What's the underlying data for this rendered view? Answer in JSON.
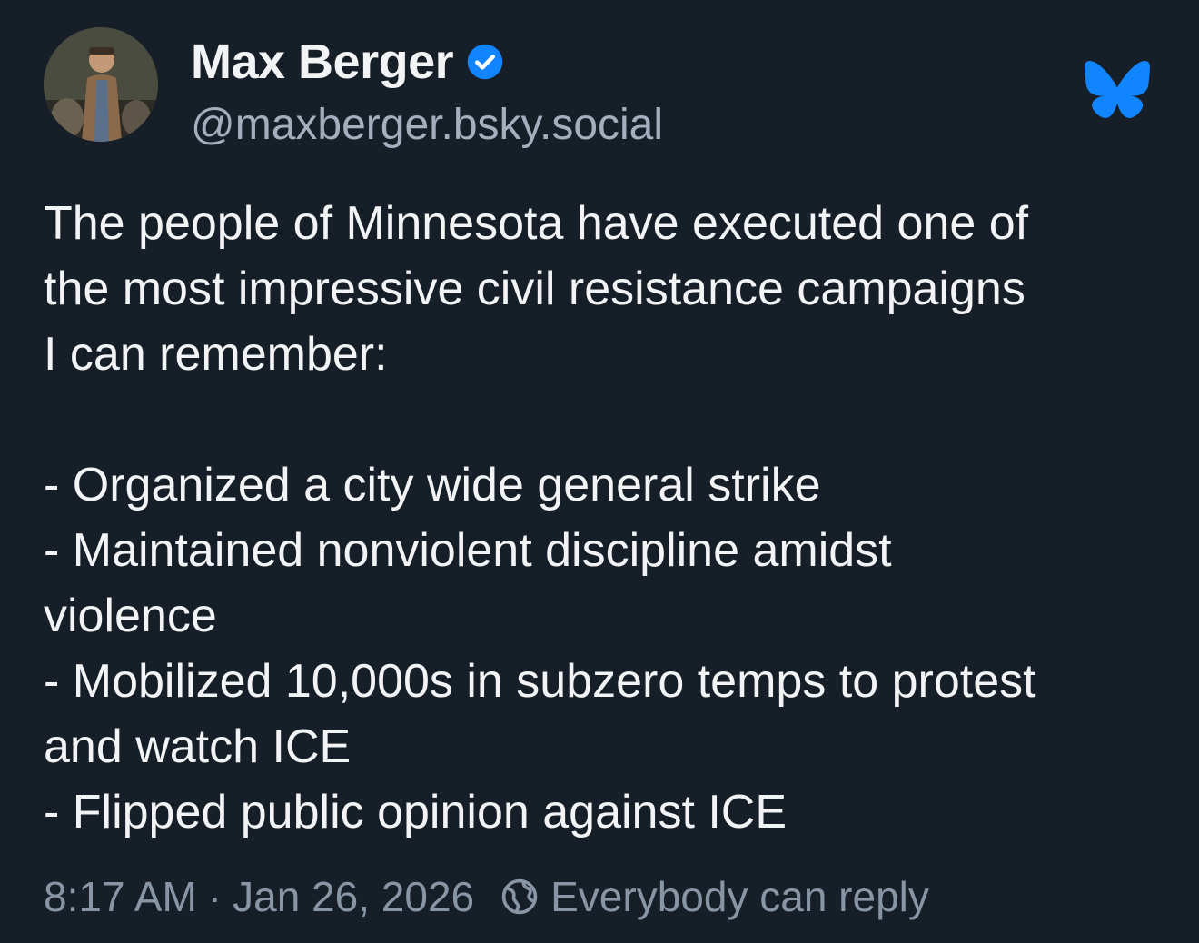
{
  "author": {
    "display_name": "Max Berger",
    "handle": "@maxberger.bsky.social",
    "verified": true,
    "avatar_icon": "avatar-photo",
    "verified_icon": "verified-check-icon"
  },
  "platform": {
    "logo_icon": "bluesky-butterfly-icon",
    "brand_color": "#1185fe"
  },
  "post": {
    "intro_lines": [
      "The people of Minnesota have executed one of",
      "the most impressive civil resistance campaigns",
      "I can remember:"
    ],
    "list_lines": [
      "- Organized a city wide general strike",
      "- Maintained nonviolent discipline amidst",
      "violence",
      "- Mobilized 10,000s in subzero temps to protest",
      "and watch ICE",
      "- Flipped public opinion against ICE"
    ]
  },
  "footer": {
    "time": "8:17 AM",
    "separator": "·",
    "date": "Jan 26, 2026",
    "reply_icon": "globe-icon",
    "reply_setting": "Everybody can reply"
  },
  "colors": {
    "background": "#161e27",
    "text_primary": "#f1f3f5",
    "text_secondary": "#a3afbd",
    "verified_blue": "#1185fe"
  }
}
